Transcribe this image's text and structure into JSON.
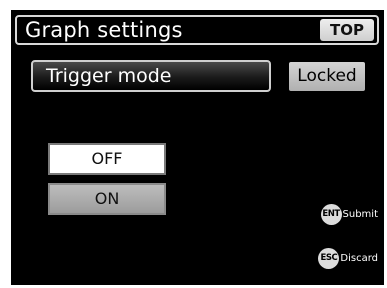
{
  "header": {
    "title": "Graph settings",
    "top_button_label": "TOP"
  },
  "setting": {
    "label": "Trigger mode",
    "status": "Locked"
  },
  "options": [
    {
      "label": "OFF",
      "selected": true
    },
    {
      "label": "ON",
      "selected": false
    }
  ],
  "hints": {
    "submit": {
      "key": "ENT",
      "label": "Submit"
    },
    "discard": {
      "key": "ESC",
      "label": "Discard"
    }
  },
  "colors": {
    "background": "#000000",
    "selected_option": "#ffffff",
    "unselected_option": "#aaaaaa",
    "badge": "#c4c4c4"
  }
}
